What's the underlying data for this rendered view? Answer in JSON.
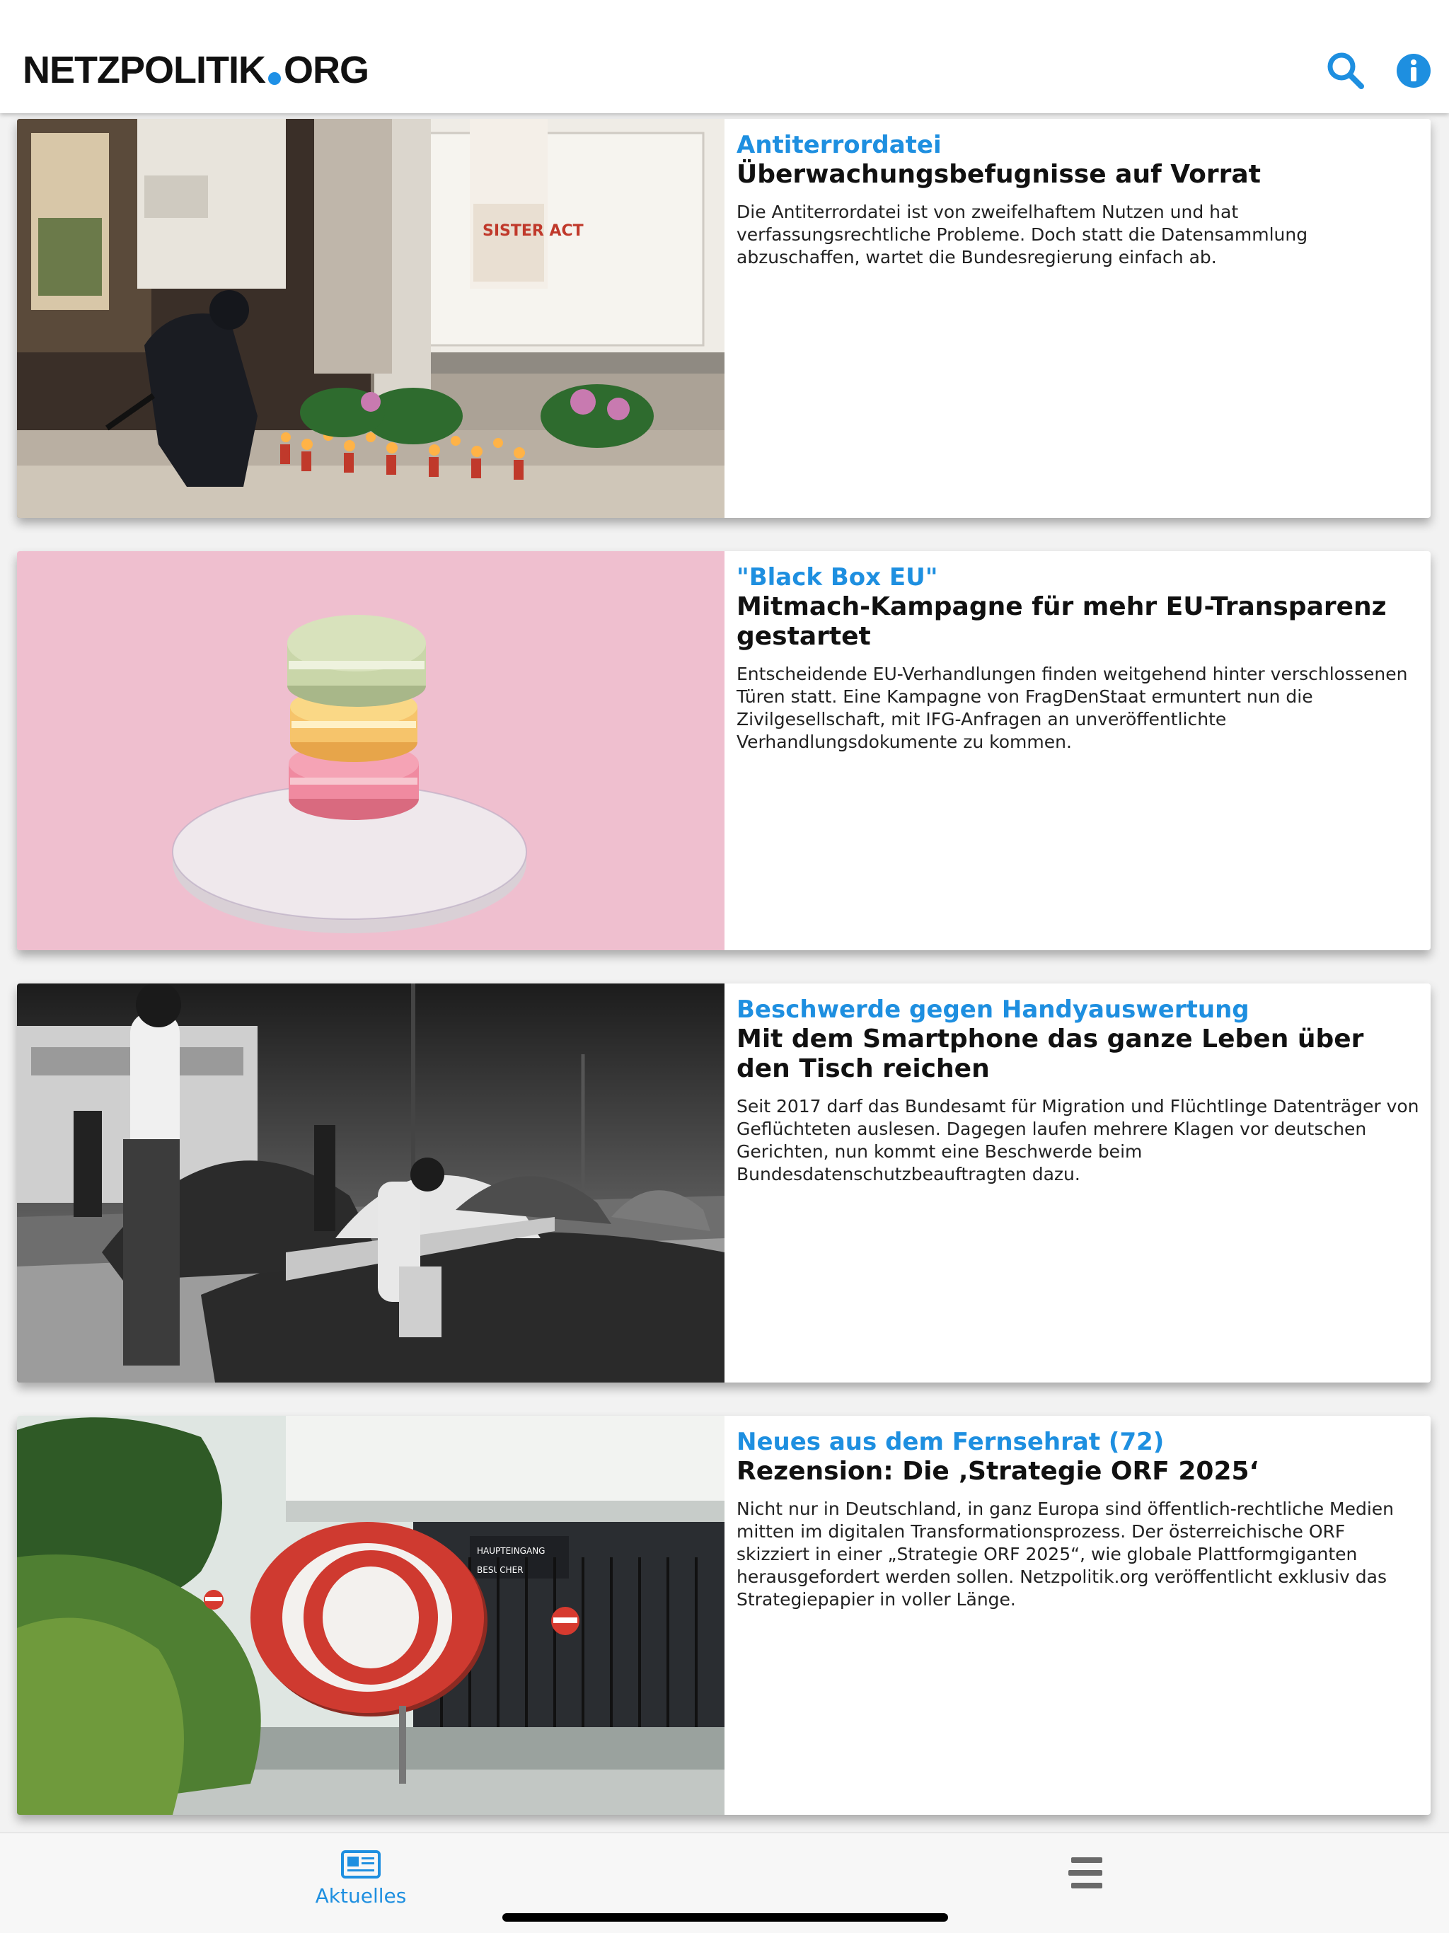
{
  "header": {
    "logo_left": "NETZPOLITIK",
    "logo_right": "ORG",
    "search_icon": "search-icon",
    "info_icon": "info-icon",
    "accent": "#1e8fe0"
  },
  "articles": [
    {
      "kicker": "Antiterrordatei",
      "title": "Überwachungsbefugnisse auf Vorrat",
      "teaser": "Die Antiterrordatei ist von zweifelhaftem Nutzen und hat verfassungsrechtliche Probleme. Doch statt die Datensammlung abzuschaffen, wartet die Bundesregierung einfach ab.",
      "image_sign": "SISTER ACT"
    },
    {
      "kicker": "\"Black Box EU\"",
      "title": "Mitmach-Kampagne für mehr EU-Transparenz gestartet",
      "teaser": "Entscheidende EU-Verhandlungen finden weitgehend hinter verschlossenen Türen statt. Eine Kampagne von FragDenStaat ermuntert nun die Zivilgesellschaft, mit IFG-Anfragen an unveröffentlichte Verhandlungsdokumente zu kommen."
    },
    {
      "kicker": "Beschwerde gegen Handyauswertung",
      "title": "Mit dem Smartphone das ganze Leben über den Tisch reichen",
      "teaser": "Seit 2017 darf das Bundesamt für Migration und Flüchtlinge Datenträger von Geflüchteten auslesen. Dagegen laufen mehrere Klagen vor deutschen Gerichten, nun kommt eine Beschwerde beim Bundesdatenschutzbeauftragten dazu."
    },
    {
      "kicker": "Neues aus dem Fernsehrat (72)",
      "title": "Rezension: Die ‚Strategie ORF 2025‘",
      "teaser": "Nicht nur in Deutschland, in ganz Europa sind öffentlich-rechtliche Medien mitten im digitalen Transformationsprozess. Der österreichische ORF skizziert in einer „Strategie ORF 2025“, wie globale Plattformgiganten herausgefordert werden sollen. Netzpolitik.org veröffentlicht exklusiv das Strategiepapier in voller Länge.",
      "image_sign_1": "HAUPTEINGANG",
      "image_sign_2": "BESUCHER"
    }
  ],
  "tabbar": {
    "news_label": "Aktuelles",
    "news_icon": "newspaper-icon",
    "menu_icon": "menu-icon"
  }
}
